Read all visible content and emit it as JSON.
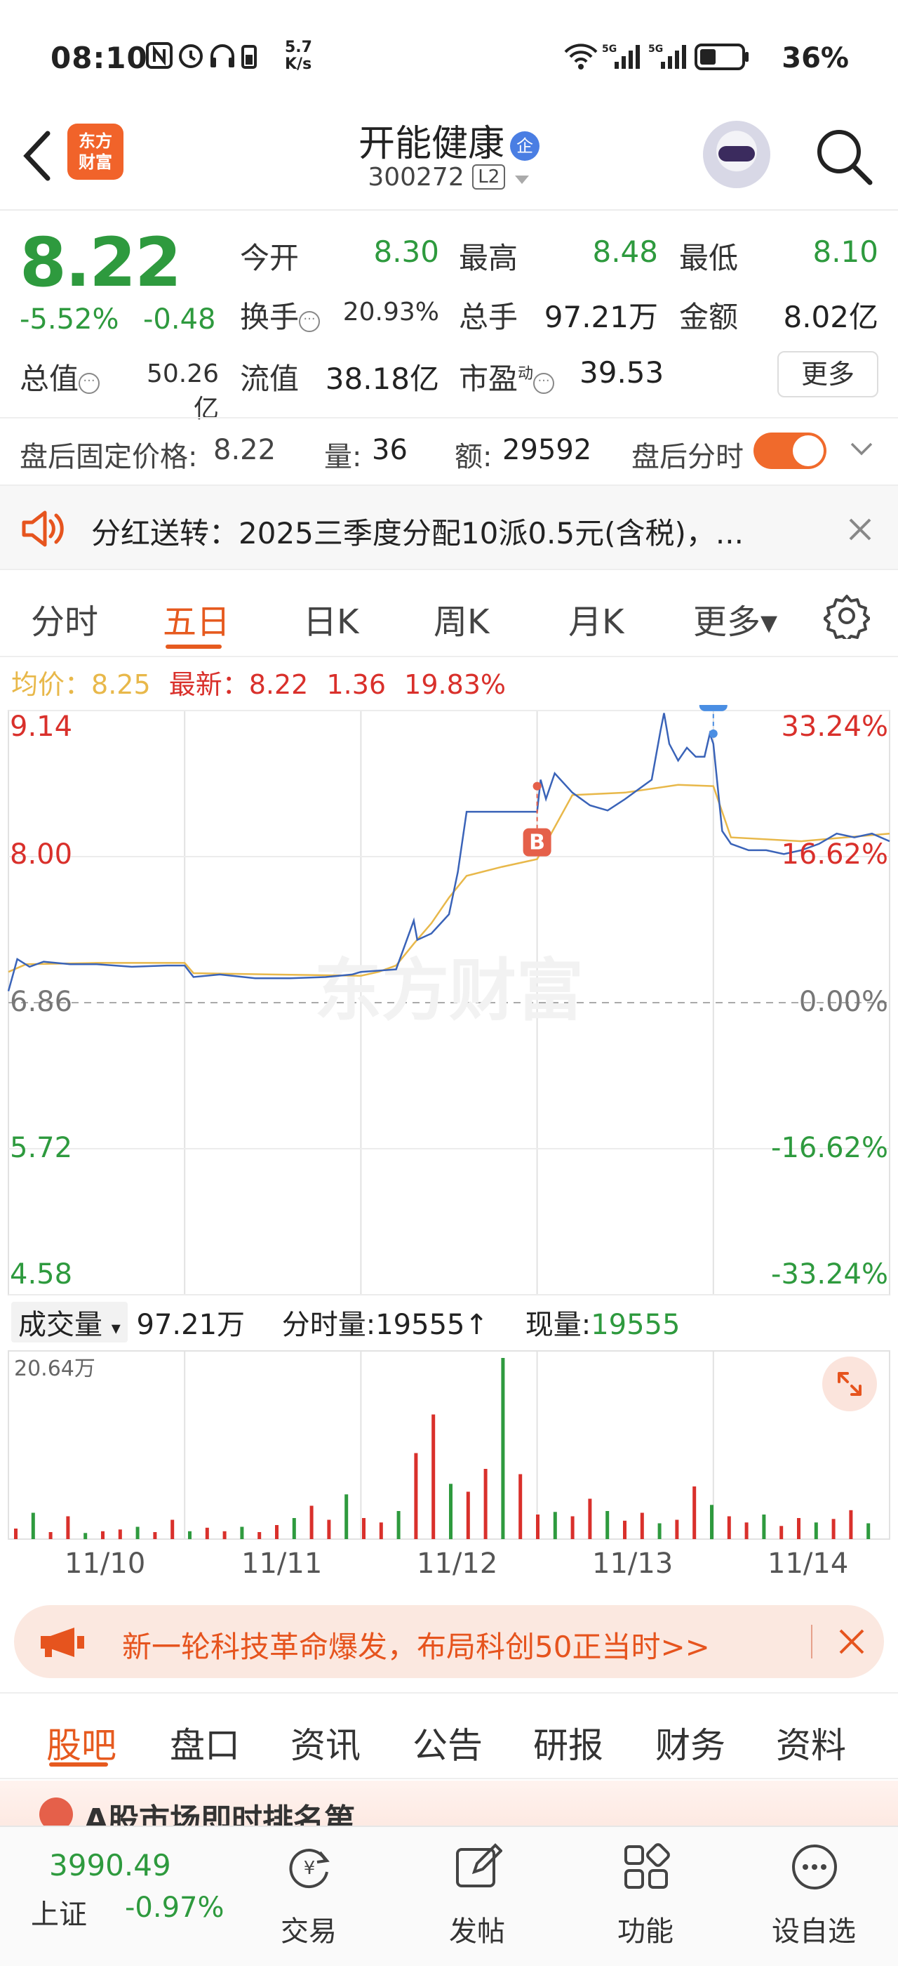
{
  "status_bar": {
    "time": "08:10",
    "net_speed_top": "5.7",
    "net_speed_bottom": "K/s",
    "battery": "36%",
    "signal_label_1": "5G",
    "signal_label_2": "5G"
  },
  "header": {
    "logo_line1": "东方",
    "logo_line2": "财富",
    "stock_name": "开能健康",
    "badge": "企",
    "stock_code": "300272",
    "level_badge": "L2"
  },
  "quote": {
    "price": "8.22",
    "change_pct": "-5.52%",
    "change_abs": "-0.48",
    "rows": [
      [
        {
          "label": "今开",
          "value": "8.30",
          "color": "green"
        },
        {
          "label": "最高",
          "value": "8.48",
          "color": "green"
        },
        {
          "label": "最低",
          "value": "8.10",
          "color": "green"
        }
      ],
      [
        {
          "label": "换手",
          "value": "20.93%",
          "color": "gray"
        },
        {
          "label": "总手",
          "value": "97.21万",
          "color": "black"
        },
        {
          "label": "金额",
          "value": "8.02亿",
          "color": "black"
        }
      ],
      [
        {
          "label": "总值",
          "value": "50.26亿",
          "color": "black"
        },
        {
          "label": "流值",
          "value": "38.18亿",
          "color": "black"
        },
        {
          "label": "市盈",
          "value": "39.53",
          "color": "black"
        }
      ]
    ],
    "pe_superscript": "动",
    "more_button": "更多"
  },
  "after_hours": {
    "label": "盘后固定价格:",
    "price": "8.22",
    "vol_label": "量:",
    "vol": "36",
    "amt_label": "额:",
    "amt": "29592",
    "toggle_label": "盘后分时",
    "toggle_on": true
  },
  "notice": {
    "text": "分红送转：2025三季度分配10派0.5元(含税)，..."
  },
  "tabs": [
    "分时",
    "五日",
    "日K",
    "周K",
    "月K",
    "更多▾"
  ],
  "active_tab": 1,
  "legend": {
    "avg_label": "均价：",
    "avg_value": "8.25",
    "latest_label": "最新：",
    "latest_value": "8.22",
    "latest_chg": "1.36",
    "latest_pct": "19.83%"
  },
  "chart_data": {
    "type": "line",
    "title": "",
    "y_left_ticks": [
      "9.14",
      "8.00",
      "6.86",
      "5.72",
      "4.58"
    ],
    "y_right_ticks": [
      "33.24%",
      "16.62%",
      "0.00%",
      "-16.62%",
      "-33.24%"
    ],
    "ylim": [
      4.58,
      9.14
    ],
    "base_price": 6.86,
    "x_days": [
      "11/10",
      "11/11",
      "11/12",
      "11/13",
      "11/14"
    ],
    "series": [
      {
        "name": "最新",
        "color": "#3a63b8",
        "x": [
          0,
          0.05,
          0.12,
          0.2,
          0.35,
          0.5,
          0.7,
          0.9,
          1.0,
          1.05,
          1.2,
          1.4,
          1.6,
          1.8,
          1.95,
          2.0,
          2.2,
          2.3,
          2.32,
          2.4,
          2.5,
          2.55,
          2.6,
          2.7,
          2.8,
          3.0,
          3.02,
          3.05,
          3.1,
          3.2,
          3.3,
          3.4,
          3.5,
          3.6,
          3.65,
          3.7,
          3.72,
          3.75,
          3.8,
          3.85,
          3.9,
          3.95,
          3.98,
          4.0,
          4.05,
          4.1,
          4.2,
          4.3,
          4.4,
          4.5,
          4.6,
          4.7,
          4.8,
          4.9,
          5.0
        ],
        "y": [
          6.95,
          7.2,
          7.14,
          7.18,
          7.16,
          7.16,
          7.14,
          7.15,
          7.15,
          7.06,
          7.08,
          7.05,
          7.05,
          7.06,
          7.08,
          7.1,
          7.12,
          7.5,
          7.35,
          7.4,
          7.55,
          7.88,
          8.35,
          8.35,
          8.35,
          8.35,
          8.6,
          8.45,
          8.65,
          8.5,
          8.4,
          8.36,
          8.45,
          8.55,
          8.6,
          8.98,
          9.12,
          8.88,
          8.75,
          8.85,
          8.78,
          8.78,
          8.96,
          8.88,
          8.2,
          8.1,
          8.05,
          8.05,
          8.02,
          8.05,
          8.1,
          8.18,
          8.15,
          8.18,
          8.12
        ]
      },
      {
        "name": "均价",
        "color": "#e8b84a",
        "x": [
          0,
          0.1,
          0.5,
          1.0,
          1.05,
          1.5,
          2.0,
          2.1,
          2.2,
          2.3,
          2.4,
          2.5,
          2.6,
          2.8,
          3.0,
          3.2,
          3.5,
          3.8,
          4.0,
          4.1,
          4.5,
          5.0
        ],
        "y": [
          7.1,
          7.16,
          7.17,
          7.17,
          7.09,
          7.08,
          7.07,
          7.1,
          7.15,
          7.32,
          7.48,
          7.68,
          7.85,
          7.92,
          7.98,
          8.48,
          8.5,
          8.56,
          8.55,
          8.15,
          8.12,
          8.18
        ]
      }
    ],
    "markers": [
      {
        "label": "B",
        "color": "#e5604a",
        "x": 3.0,
        "y": 8.55
      },
      {
        "label": "S",
        "color": "#4a8ee3",
        "x": 4.0,
        "y": 8.96
      }
    ]
  },
  "volume": {
    "selector_label": "成交量",
    "total": "97.21万",
    "fenshi_label": "分时量:",
    "fenshi_value": "19555↑",
    "current_label": "现量:",
    "current_value": "19555",
    "max_label": "20.64万",
    "ylim": [
      0,
      206400
    ],
    "bars_description_values_wan": [
      1.2,
      3.0,
      0.8,
      2.6,
      0.7,
      0.9,
      1.1,
      1.4,
      0.8,
      2.2,
      0.9,
      1.3,
      0.9,
      1.4,
      0.8,
      1.6,
      2.4,
      3.8,
      2.2,
      5.1,
      2.4,
      1.9,
      3.2,
      9.8,
      14.2,
      6.3,
      5.4,
      8.0,
      20.64,
      7.4,
      2.8,
      3.1,
      2.6,
      4.6,
      3.2,
      2.1,
      3.0,
      1.8,
      2.2,
      6.0,
      3.9,
      2.6,
      1.9,
      2.8,
      1.5,
      2.4,
      1.9,
      2.3,
      3.3,
      1.8
    ]
  },
  "promo_banner": {
    "text": "新一轮科技革命爆发，布局科创50正当时>>"
  },
  "bottom_tabs": [
    "股吧",
    "盘口",
    "资讯",
    "公告",
    "研报",
    "财务",
    "资料"
  ],
  "active_bottom_tab": 0,
  "peek_text": "A股市场即时排名第",
  "nav": {
    "index_value": "3990.49",
    "index_name": "上证",
    "index_pct": "-0.97%",
    "items": [
      "交易",
      "发帖",
      "功能",
      "设自选"
    ]
  },
  "colors": {
    "accent": "#e65a1f",
    "down": "#2e9a3e",
    "up": "#d9302b",
    "price_line": "#3a63b8",
    "avg_line": "#e8b84a"
  }
}
